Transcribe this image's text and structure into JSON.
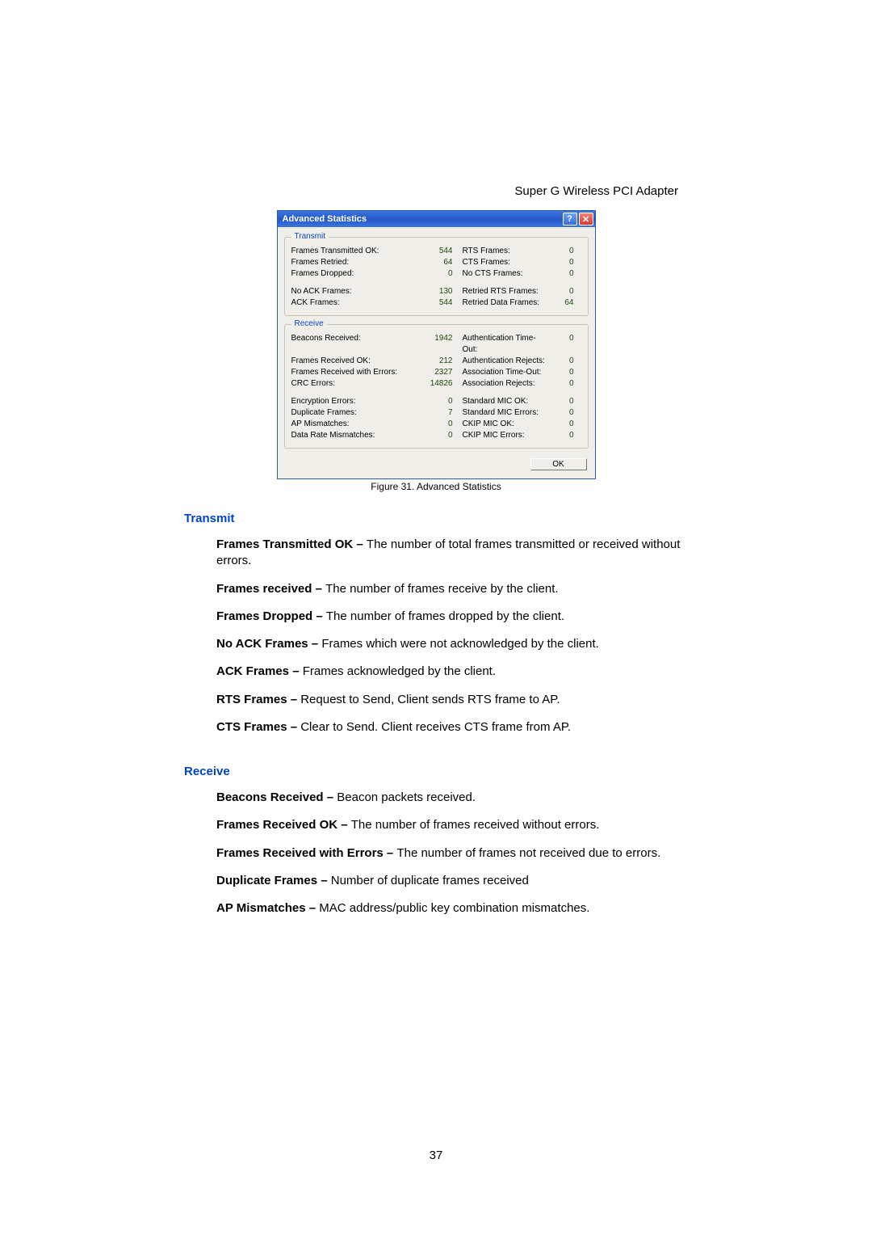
{
  "header": {
    "title": "Super G Wireless PCI Adapter"
  },
  "dialog": {
    "title": "Advanced Statistics",
    "help": "?",
    "close": "✕",
    "ok": "OK",
    "transmit": {
      "legend": "Transmit",
      "rows": [
        {
          "l": "Frames Transmitted OK:",
          "v": "544",
          "l2": "RTS Frames:",
          "v2": "0"
        },
        {
          "l": "Frames Retried:",
          "v": "64",
          "l2": "CTS Frames:",
          "v2": "0"
        },
        {
          "l": "Frames Dropped:",
          "v": "0",
          "l2": "No CTS Frames:",
          "v2": "0"
        }
      ],
      "rows2": [
        {
          "l": "No ACK Frames:",
          "v": "130",
          "l2": "Retried RTS Frames:",
          "v2": "0"
        },
        {
          "l": "ACK Frames:",
          "v": "544",
          "l2": "Retried Data Frames:",
          "v2": "64"
        }
      ]
    },
    "receive": {
      "legend": "Receive",
      "rows": [
        {
          "l": "Beacons Received:",
          "v": "1942",
          "l2": "Authentication Time-Out:",
          "v2": "0"
        },
        {
          "l": "Frames Received OK:",
          "v": "212",
          "l2": "Authentication Rejects:",
          "v2": "0"
        },
        {
          "l": "Frames Received with Errors:",
          "v": "2327",
          "l2": "Association Time-Out:",
          "v2": "0"
        },
        {
          "l": "CRC Errors:",
          "v": "14826",
          "l2": "Association Rejects:",
          "v2": "0"
        }
      ],
      "rows2": [
        {
          "l": "Encryption Errors:",
          "v": "0",
          "l2": "Standard MIC OK:",
          "v2": "0"
        },
        {
          "l": "Duplicate Frames:",
          "v": "7",
          "l2": "Standard MIC Errors:",
          "v2": "0"
        },
        {
          "l": "AP Mismatches:",
          "v": "0",
          "l2": "CKIP MIC OK:",
          "v2": "0"
        },
        {
          "l": "Data Rate Mismatches:",
          "v": "0",
          "l2": "CKIP MIC Errors:",
          "v2": "0"
        }
      ]
    }
  },
  "caption": "Figure 31. Advanced Statistics",
  "sections": {
    "transmit": {
      "head": "Transmit",
      "items": [
        {
          "term": "Frames Transmitted OK – ",
          "desc": "The number of total frames transmitted or received without errors."
        },
        {
          "term": "Frames received – ",
          "desc": "The number of frames receive by the client."
        },
        {
          "term": "Frames Dropped – ",
          "desc": "The number of frames dropped by the client."
        },
        {
          "term": "No ACK Frames – ",
          "desc": "Frames which were not acknowledged by the client."
        },
        {
          "term": "ACK Frames – ",
          "desc": "Frames acknowledged by the client."
        },
        {
          "term": "RTS Frames – ",
          "desc": "Request to Send, Client sends RTS frame to AP."
        },
        {
          "term": "CTS Frames – ",
          "desc": "Clear to Send. Client receives CTS frame from AP."
        }
      ]
    },
    "receive": {
      "head": "Receive",
      "items": [
        {
          "term": "Beacons Received – ",
          "desc": "Beacon packets received."
        },
        {
          "term": "Frames Received OK – ",
          "desc": "The number of frames received without errors."
        },
        {
          "term": "Frames Received with Errors – ",
          "desc": "The number of frames not received due to errors."
        },
        {
          "term": "Duplicate Frames – ",
          "desc": "Number of duplicate frames received"
        },
        {
          "term": "AP Mismatches – ",
          "desc": "MAC address/public key combination mismatches."
        }
      ]
    }
  },
  "pagenum": "37"
}
